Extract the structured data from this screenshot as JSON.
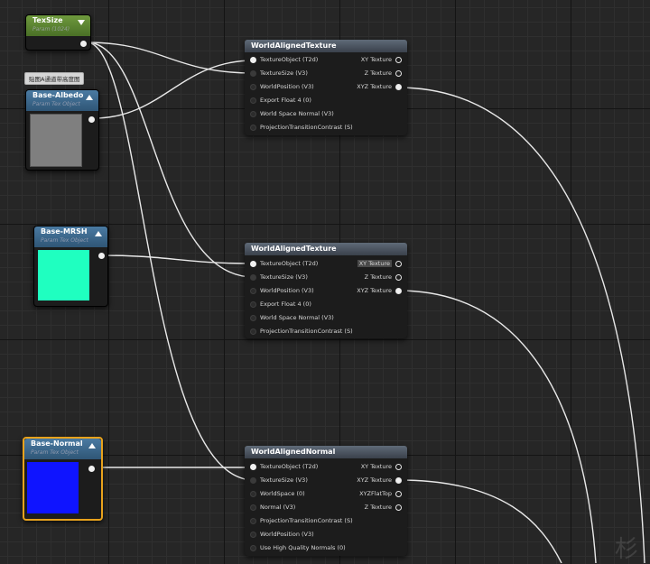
{
  "colors": {
    "texsize_header": "#5e8a32",
    "tex_object_header": "#3f6a8e",
    "albedo_swatch": "#7f7f7f",
    "mrsh_swatch": "#1fffc0",
    "normal_swatch": "#0f14ff",
    "selected_border": "#e8a21c",
    "wire": "#e8e8e8"
  },
  "comment_tooltip": "贴图A通道带高度图",
  "watermark": "杉",
  "params": {
    "texsize": {
      "title": "TexSize",
      "subtitle": "Param (1024)"
    },
    "albedo": {
      "title": "Base-Albedo",
      "subtitle": "Param Tex Object"
    },
    "mrsh": {
      "title": "Base-MRSH",
      "subtitle": "Param Tex Object"
    },
    "normal": {
      "title": "Base-Normal",
      "subtitle": "Param Tex Object"
    }
  },
  "nodes": {
    "wat1": {
      "title": "WorldAlignedTexture",
      "inputs": [
        "TextureObject (T2d)",
        "TextureSize (V3)",
        "WorldPosition (V3)",
        "Export Float 4 (0)",
        "World Space Normal (V3)",
        "ProjectionTransitionContrast (S)"
      ],
      "outputs": [
        "XY Texture",
        "Z Texture",
        "XYZ Texture"
      ]
    },
    "wat2": {
      "title": "WorldAlignedTexture",
      "inputs": [
        "TextureObject (T2d)",
        "TextureSize (V3)",
        "WorldPosition (V3)",
        "Export Float 4 (0)",
        "World Space Normal (V3)",
        "ProjectionTransitionContrast (S)"
      ],
      "outputs": [
        "XY Texture",
        "Z Texture",
        "XYZ Texture"
      ]
    },
    "wan": {
      "title": "WorldAlignedNormal",
      "inputs": [
        "TextureObject (T2d)",
        "TextureSize (V3)",
        "WorldSpace (0)",
        "Normal (V3)",
        "ProjectionTransitionContrast (S)",
        "WorldPosition (V3)",
        "Use High Quality Normals (0)"
      ],
      "outputs": [
        "XY Texture",
        "XYZ Texture",
        "XYZFlatTop",
        "Z Texture"
      ]
    }
  }
}
